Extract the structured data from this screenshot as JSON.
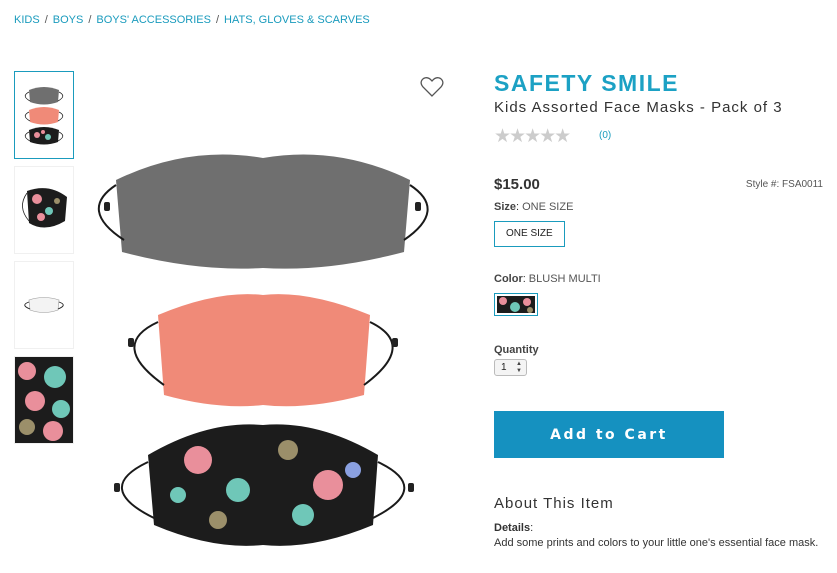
{
  "breadcrumb": {
    "items": [
      "KIDS",
      "BOYS",
      "BOYS' ACCESSORIES",
      "HATS, GLOVES & SCARVES"
    ],
    "separator": "/"
  },
  "product": {
    "brand": "SAFETY SMILE",
    "title": "Kids Assorted Face Masks - Pack of 3",
    "rating_stars": "★★★★★",
    "review_count": "(0)",
    "price": "$15.00",
    "style_number": "Style #: FSA0011",
    "size_label": "Size",
    "size_value": "ONE SIZE",
    "size_option": "ONE SIZE",
    "color_label": "Color",
    "color_value": "BLUSH MULTI",
    "quantity_label": "Quantity",
    "quantity_value": "1",
    "add_to_cart": "Add to Cart",
    "about_heading": "About This Item",
    "details_label": "Details",
    "details_text": "Add some prints and colors to your little one's essential face mask."
  },
  "colors": {
    "accent": "#1a9bbd",
    "button": "#1591c0",
    "mask_gray": "#6f6f6f",
    "mask_coral": "#f08a78",
    "mask_print": "#1c1c1c"
  },
  "icons": {
    "wishlist": "heart-outline-icon"
  }
}
